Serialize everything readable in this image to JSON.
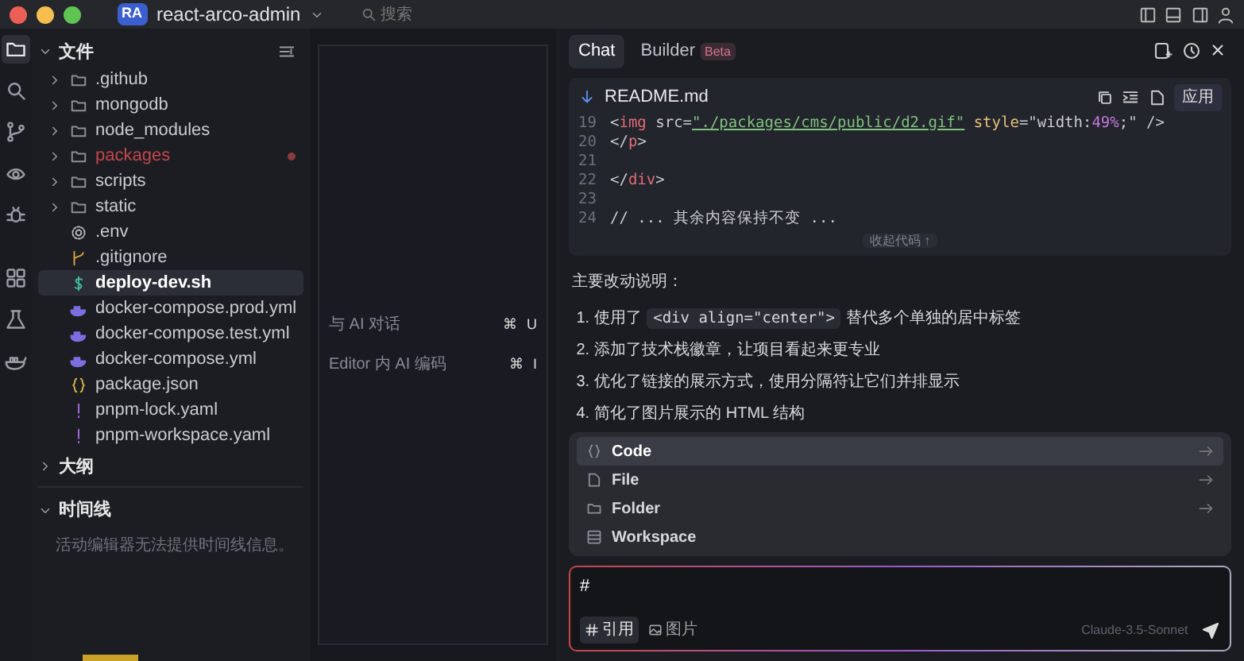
{
  "titlebar": {
    "app_badge": "RA",
    "project": "react-arco-admin",
    "search": "搜索"
  },
  "activity_bar": [
    {
      "kind": "files",
      "selected": true
    },
    {
      "kind": "search",
      "selected": false
    },
    {
      "kind": "branch",
      "selected": false
    },
    {
      "kind": "remote",
      "selected": false
    },
    {
      "kind": "debug",
      "selected": false
    },
    {
      "kind": "extensions",
      "selected": false
    },
    {
      "kind": "flask",
      "selected": false
    },
    {
      "kind": "docker",
      "selected": false
    }
  ],
  "explorer": {
    "title": "文件",
    "expanded": true,
    "items": [
      {
        "name": ".github",
        "kind": "folder",
        "selected": false,
        "modified": false
      },
      {
        "name": "mongodb",
        "kind": "folder",
        "selected": false,
        "modified": false
      },
      {
        "name": "node_modules",
        "kind": "folder",
        "selected": false,
        "modified": false
      },
      {
        "name": "packages",
        "kind": "folder",
        "selected": false,
        "modified": true
      },
      {
        "name": "scripts",
        "kind": "folder",
        "selected": false,
        "modified": false
      },
      {
        "name": "static",
        "kind": "folder",
        "selected": false,
        "modified": false
      },
      {
        "name": ".env",
        "kind": "gear",
        "selected": false,
        "modified": false
      },
      {
        "name": ".gitignore",
        "kind": "git",
        "selected": false,
        "modified": false
      },
      {
        "name": "deploy-dev.sh",
        "kind": "shell",
        "selected": true,
        "modified": false
      },
      {
        "name": "docker-compose.prod.yml",
        "kind": "docker",
        "selected": false,
        "modified": false
      },
      {
        "name": "docker-compose.test.yml",
        "kind": "docker",
        "selected": false,
        "modified": false
      },
      {
        "name": "docker-compose.yml",
        "kind": "docker",
        "selected": false,
        "modified": false
      },
      {
        "name": "package.json",
        "kind": "json",
        "selected": false,
        "modified": false
      },
      {
        "name": "pnpm-lock.yaml",
        "kind": "yaml",
        "selected": false,
        "modified": false
      },
      {
        "name": "pnpm-workspace.yaml",
        "kind": "yaml",
        "selected": false,
        "modified": false
      }
    ]
  },
  "outline": {
    "title": "大纲",
    "expanded": false
  },
  "timeline": {
    "title": "时间线",
    "expanded": true,
    "message": "活动编辑器无法提供时间线信息。"
  },
  "editor_hints": [
    {
      "label": "与 AI 对话",
      "keys": [
        "⌘",
        "U"
      ]
    },
    {
      "label": "Editor 内 AI 编码",
      "keys": [
        "⌘",
        "I"
      ]
    }
  ],
  "chat": {
    "tabs": [
      {
        "label": "Chat",
        "selected": true
      },
      {
        "label": "Builder",
        "badge": "Beta",
        "selected": false
      }
    ],
    "code_block": {
      "filename": "README.md",
      "apply": "应用",
      "collapse": "收起代码 ↑",
      "lines": [
        {
          "number": "19",
          "tokens": [
            {
              "text": "<",
              "kind": "punct"
            },
            {
              "text": "img",
              "kind": "tag"
            },
            {
              "text": " src=",
              "kind": "attr"
            },
            {
              "text": "\"./packages/cms/public/d2.gif\"",
              "kind": "string"
            },
            {
              "text": " style",
              "kind": "key"
            },
            {
              "text": "=\"width:",
              "kind": "attr"
            },
            {
              "text": "49%",
              "kind": "number"
            },
            {
              "text": ";\" />",
              "kind": "attr"
            }
          ]
        },
        {
          "number": "20",
          "tokens": [
            {
              "text": "</",
              "kind": "punct"
            },
            {
              "text": "p",
              "kind": "tag"
            },
            {
              "text": ">",
              "kind": "punct"
            }
          ]
        },
        {
          "number": "21"
        },
        {
          "number": "22",
          "tokens": [
            {
              "text": "</",
              "kind": "punct"
            },
            {
              "text": "div",
              "kind": "tag"
            },
            {
              "text": ">",
              "kind": "punct"
            }
          ]
        },
        {
          "number": "23"
        },
        {
          "number": "24",
          "tokens": [
            {
              "text": "// ... 其余内容保持不变 ...",
              "kind": "plain"
            }
          ]
        }
      ]
    },
    "message": {
      "intro": "主要改动说明：",
      "points": [
        {
          "number": "1.",
          "before": "使用了",
          "code": "<div align=\"center\">",
          "after": "替代多个单独的居中标签"
        },
        {
          "number": "2.",
          "before": "添加了技术栈徽章，让项目看起来更专业"
        },
        {
          "number": "3.",
          "before": "优化了链接的展示方式，使用分隔符让它们并排显示"
        },
        {
          "number": "4.",
          "before": "简化了图片展示的 HTML 结构"
        }
      ]
    },
    "context_menu": [
      {
        "label": "Code",
        "kind": "code",
        "selected": true,
        "arrow": true
      },
      {
        "label": "File",
        "kind": "file",
        "selected": false,
        "arrow": true
      },
      {
        "label": "Folder",
        "kind": "folder",
        "selected": false,
        "arrow": true
      },
      {
        "label": "Workspace",
        "kind": "workspace",
        "selected": false,
        "arrow": false
      }
    ],
    "input": {
      "value": "#",
      "buttons": [
        {
          "label": "引用",
          "kind": "mention"
        },
        {
          "label": "图片",
          "kind": "image"
        }
      ],
      "model": "Claude-3.5-Sonnet"
    }
  }
}
